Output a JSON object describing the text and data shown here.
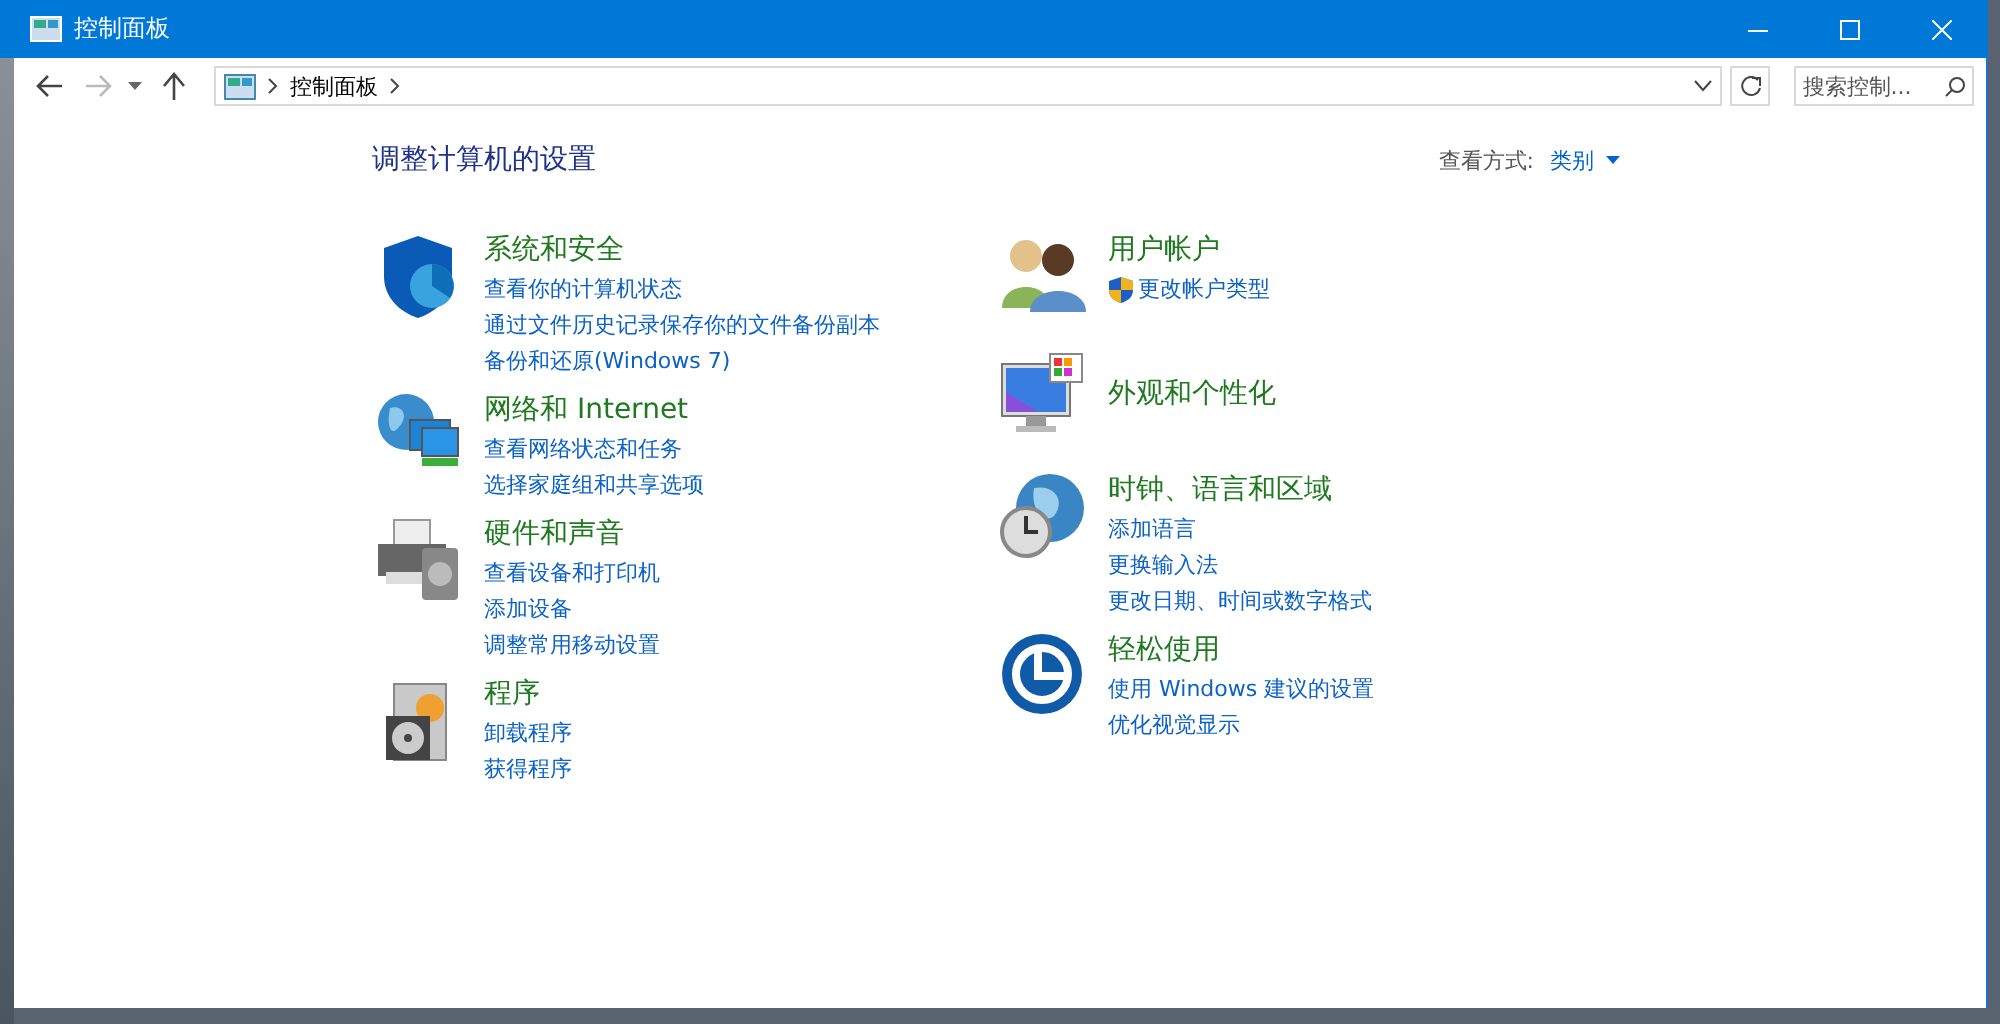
{
  "window": {
    "title": "控制面板"
  },
  "address_bar": {
    "path": [
      "控制面板"
    ]
  },
  "search": {
    "placeholder": "搜索控制..."
  },
  "heading": "调整计算机的设置",
  "view_by": {
    "label": "查看方式:",
    "value": "类别"
  },
  "columns": [
    [
      {
        "title": "系统和安全",
        "links": [
          {
            "text": "查看你的计算机状态",
            "shielded": false
          },
          {
            "text": "通过文件历史记录保存你的文件备份副本",
            "shielded": false
          },
          {
            "text": "备份和还原(Windows 7)",
            "shielded": false
          }
        ]
      },
      {
        "title": "网络和 Internet",
        "links": [
          {
            "text": "查看网络状态和任务",
            "shielded": false
          },
          {
            "text": "选择家庭组和共享选项",
            "shielded": false
          }
        ]
      },
      {
        "title": "硬件和声音",
        "links": [
          {
            "text": "查看设备和打印机",
            "shielded": false
          },
          {
            "text": "添加设备",
            "shielded": false
          },
          {
            "text": "调整常用移动设置",
            "shielded": false
          }
        ]
      },
      {
        "title": "程序",
        "links": [
          {
            "text": "卸载程序",
            "shielded": false
          },
          {
            "text": "获得程序",
            "shielded": false
          }
        ]
      }
    ],
    [
      {
        "title": "用户帐户",
        "links": [
          {
            "text": "更改帐户类型",
            "shielded": true
          }
        ]
      },
      {
        "title": "外观和个性化"
      },
      {
        "title": "时钟、语言和区域",
        "links": [
          {
            "text": "添加语言",
            "shielded": false
          },
          {
            "text": "更换输入法",
            "shielded": false
          },
          {
            "text": "更改日期、时间或数字格式",
            "shielded": false
          }
        ]
      },
      {
        "title": "轻松使用",
        "links": [
          {
            "text": "使用 Windows 建议的设置",
            "shielded": false
          },
          {
            "text": "优化视觉显示",
            "shielded": false
          }
        ]
      }
    ]
  ]
}
